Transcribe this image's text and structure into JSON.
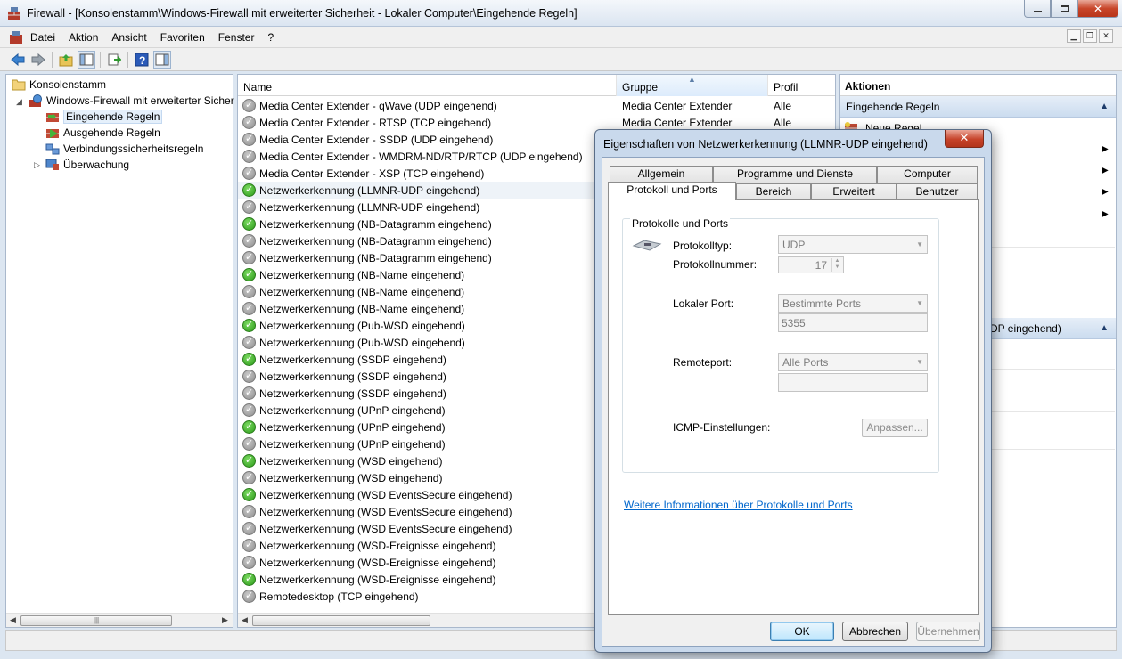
{
  "window": {
    "title": "Firewall - [Konsolenstamm\\Windows-Firewall mit erweiterter Sicherheit - Lokaler Computer\\Eingehende Regeln]",
    "min_label": "▭",
    "max_label": "▢",
    "close_label": "✕"
  },
  "menu": {
    "items": [
      "Datei",
      "Aktion",
      "Ansicht",
      "Favoriten",
      "Fenster",
      "?"
    ]
  },
  "tree": {
    "root": "Konsolenstamm",
    "firewall": "Windows-Firewall mit erweiterter Sicher",
    "inbound": "Eingehende Regeln",
    "outbound": "Ausgehende Regeln",
    "connsec": "Verbindungssicherheitsregeln",
    "monitoring": "Überwachung"
  },
  "list": {
    "columns": [
      "Name",
      "Gruppe",
      "Profil"
    ],
    "rows": [
      {
        "name": "Media Center Extender - qWave (UDP eingehend)",
        "group": "Media Center Extender",
        "profile": "Alle",
        "enabled": false
      },
      {
        "name": "Media Center Extender - RTSP (TCP eingehend)",
        "group": "Media Center Extender",
        "profile": "Alle",
        "enabled": false
      },
      {
        "name": "Media Center Extender - SSDP (UDP eingehend)",
        "group": "",
        "profile": "",
        "enabled": false
      },
      {
        "name": "Media Center Extender - WMDRM-ND/RTP/RTCP (UDP eingehend)",
        "group": "",
        "profile": "",
        "enabled": false
      },
      {
        "name": "Media Center Extender - XSP (TCP eingehend)",
        "group": "",
        "profile": "",
        "enabled": false
      },
      {
        "name": "Netzwerkerkennung (LLMNR-UDP eingehend)",
        "group": "",
        "profile": "",
        "enabled": true
      },
      {
        "name": "Netzwerkerkennung (LLMNR-UDP eingehend)",
        "group": "",
        "profile": "",
        "enabled": false
      },
      {
        "name": "Netzwerkerkennung (NB-Datagramm eingehend)",
        "group": "",
        "profile": "",
        "enabled": true
      },
      {
        "name": "Netzwerkerkennung (NB-Datagramm eingehend)",
        "group": "",
        "profile": "",
        "enabled": false
      },
      {
        "name": "Netzwerkerkennung (NB-Datagramm eingehend)",
        "group": "",
        "profile": "",
        "enabled": false
      },
      {
        "name": "Netzwerkerkennung (NB-Name eingehend)",
        "group": "",
        "profile": "",
        "enabled": true
      },
      {
        "name": "Netzwerkerkennung (NB-Name eingehend)",
        "group": "",
        "profile": "",
        "enabled": false
      },
      {
        "name": "Netzwerkerkennung (NB-Name eingehend)",
        "group": "",
        "profile": "",
        "enabled": false
      },
      {
        "name": "Netzwerkerkennung (Pub-WSD eingehend)",
        "group": "",
        "profile": "",
        "enabled": true
      },
      {
        "name": "Netzwerkerkennung (Pub-WSD eingehend)",
        "group": "",
        "profile": "",
        "enabled": false
      },
      {
        "name": "Netzwerkerkennung (SSDP eingehend)",
        "group": "",
        "profile": "",
        "enabled": true
      },
      {
        "name": "Netzwerkerkennung (SSDP eingehend)",
        "group": "",
        "profile": "",
        "enabled": false
      },
      {
        "name": "Netzwerkerkennung (SSDP eingehend)",
        "group": "",
        "profile": "",
        "enabled": false
      },
      {
        "name": "Netzwerkerkennung (UPnP eingehend)",
        "group": "",
        "profile": "",
        "enabled": false
      },
      {
        "name": "Netzwerkerkennung (UPnP eingehend)",
        "group": "",
        "profile": "",
        "enabled": true
      },
      {
        "name": "Netzwerkerkennung (UPnP eingehend)",
        "group": "",
        "profile": "",
        "enabled": false
      },
      {
        "name": "Netzwerkerkennung (WSD eingehend)",
        "group": "",
        "profile": "",
        "enabled": true
      },
      {
        "name": "Netzwerkerkennung (WSD eingehend)",
        "group": "",
        "profile": "",
        "enabled": false
      },
      {
        "name": "Netzwerkerkennung (WSD EventsSecure eingehend)",
        "group": "",
        "profile": "",
        "enabled": true
      },
      {
        "name": "Netzwerkerkennung (WSD EventsSecure eingehend)",
        "group": "",
        "profile": "",
        "enabled": false
      },
      {
        "name": "Netzwerkerkennung (WSD EventsSecure eingehend)",
        "group": "",
        "profile": "",
        "enabled": false
      },
      {
        "name": "Netzwerkerkennung (WSD-Ereignisse eingehend)",
        "group": "",
        "profile": "",
        "enabled": false
      },
      {
        "name": "Netzwerkerkennung (WSD-Ereignisse eingehend)",
        "group": "",
        "profile": "",
        "enabled": false
      },
      {
        "name": "Netzwerkerkennung (WSD-Ereignisse eingehend)",
        "group": "",
        "profile": "",
        "enabled": true
      },
      {
        "name": "Remotedesktop (TCP eingehend)",
        "group": "",
        "profile": "",
        "enabled": false
      }
    ]
  },
  "actions": {
    "header": "Aktionen",
    "section1": "Eingehende Regeln",
    "new_rule": "Neue Regel...",
    "section2_tail": "DP eingehend)"
  },
  "dialog": {
    "title": "Eigenschaften von Netzwerkerkennung (LLMNR-UDP eingehend)",
    "close_label": "✕",
    "tabs_row1": [
      "Allgemein",
      "Programme und Dienste",
      "Computer"
    ],
    "tabs_row2": [
      "Protokoll und Ports",
      "Bereich",
      "Erweitert",
      "Benutzer"
    ],
    "group_title": "Protokolle und Ports",
    "protocol_type_label": "Protokolltyp:",
    "protocol_type_value": "UDP",
    "protocol_number_label": "Protokollnummer:",
    "protocol_number_value": "17",
    "local_port_label": "Lokaler Port:",
    "local_port_value": "Bestimmte Ports",
    "local_port_text": "5355",
    "remote_port_label": "Remoteport:",
    "remote_port_value": "Alle Ports",
    "remote_port_text": "",
    "icmp_label": "ICMP-Einstellungen:",
    "icmp_button": "Anpassen...",
    "link": "Weitere Informationen über Protokolle und Ports",
    "ok": "OK",
    "cancel": "Abbrechen",
    "apply": "Übernehmen"
  }
}
